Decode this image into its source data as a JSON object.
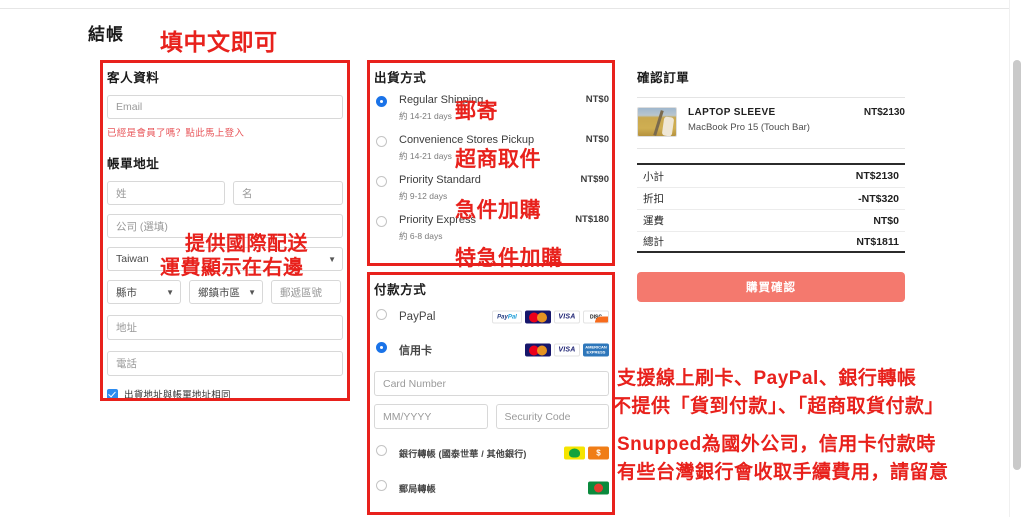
{
  "page": {
    "title": "結帳"
  },
  "annotations": {
    "fill_chinese": "填中文即可",
    "mail": "郵寄",
    "cvs": "超商取件",
    "priority": "急件加購",
    "express": "特急件加購",
    "intl_shipping": "提供國際配送",
    "fee_right": "運費顯示在右邊",
    "payment_line1": "支援線上刷卡、PayPal、銀行轉帳",
    "payment_line2": "不提供「貨到付款」、「超商取貨付款」",
    "note_line1": "Snupped為國外公司，信用卡付款時",
    "note_line2": "有些台灣銀行會收取手續費用，請留意",
    "color": "#e8211c"
  },
  "guest": {
    "heading": "客人資料",
    "email_placeholder": "Email",
    "login_link": "已經是會員了嗎？點此馬上登入"
  },
  "billing": {
    "heading": "帳單地址",
    "first_name_placeholder": "姓",
    "last_name_placeholder": "名",
    "company_placeholder": "公司 (選填)",
    "country_value": "Taiwan",
    "city_value": "縣市",
    "district_value": "鄉鎮市區",
    "zip_placeholder": "郵遞區號",
    "address_placeholder": "地址",
    "phone_placeholder": "電話",
    "same_address_label": "出貨地址與帳單地址相同",
    "same_address_checked": true
  },
  "shipping": {
    "heading": "出貨方式",
    "options": [
      {
        "name": "Regular Shipping",
        "eta": "約 14-21 days",
        "price": "NT$0",
        "selected": true
      },
      {
        "name": "Convenience Stores Pickup",
        "eta": "約 14-21 days",
        "price": "NT$0",
        "selected": false
      },
      {
        "name": "Priority Standard",
        "eta": "約 9-12 days",
        "price": "NT$90",
        "selected": false
      },
      {
        "name": "Priority Express",
        "eta": "約 6-8 days",
        "price": "NT$180",
        "selected": false
      }
    ]
  },
  "payment": {
    "heading": "付款方式",
    "paypal_label": "PayPal",
    "paypal_selected": false,
    "paypal_logos": [
      "paypal-logo",
      "mastercard-logo",
      "visa-logo",
      "discover-logo"
    ],
    "creditcard_label": "信用卡",
    "creditcard_selected": true,
    "creditcard_logos": [
      "mastercard-logo",
      "visa-logo",
      "amex-logo"
    ],
    "card_number_placeholder": "Card Number",
    "expiry_placeholder": "MM/YYYY",
    "cvc_placeholder": "Security Code",
    "bank_transfer_label": "銀行轉帳 (國泰世華 / 其他銀行)",
    "bank_transfer_selected": false,
    "bank_logos": [
      "cathay-bank-logo",
      "other-bank-logo"
    ],
    "post_transfer_label": "郵局轉帳",
    "post_transfer_selected": false,
    "post_logos": [
      "post-office-logo"
    ],
    "logo_text": {
      "paypal_pay": "Pay",
      "paypal_pal": "Pal",
      "visa": "VISA",
      "discover": "DISC",
      "amex": "AMERICAN EXPRESS",
      "dollar": "$"
    }
  },
  "order": {
    "heading": "確認訂單",
    "item": {
      "title": "LAPTOP SLEEVE",
      "subtitle": "MacBook Pro 15 (Touch Bar)",
      "price": "NT$2130"
    },
    "totals": [
      {
        "label": "小計",
        "value": "NT$2130"
      },
      {
        "label": "折扣",
        "value": "-NT$320"
      },
      {
        "label": "運費",
        "value": "NT$0"
      }
    ],
    "grand": {
      "label": "總計",
      "value": "NT$1811"
    },
    "confirm_button": "購買確認",
    "confirm_color": "#f4796e"
  }
}
